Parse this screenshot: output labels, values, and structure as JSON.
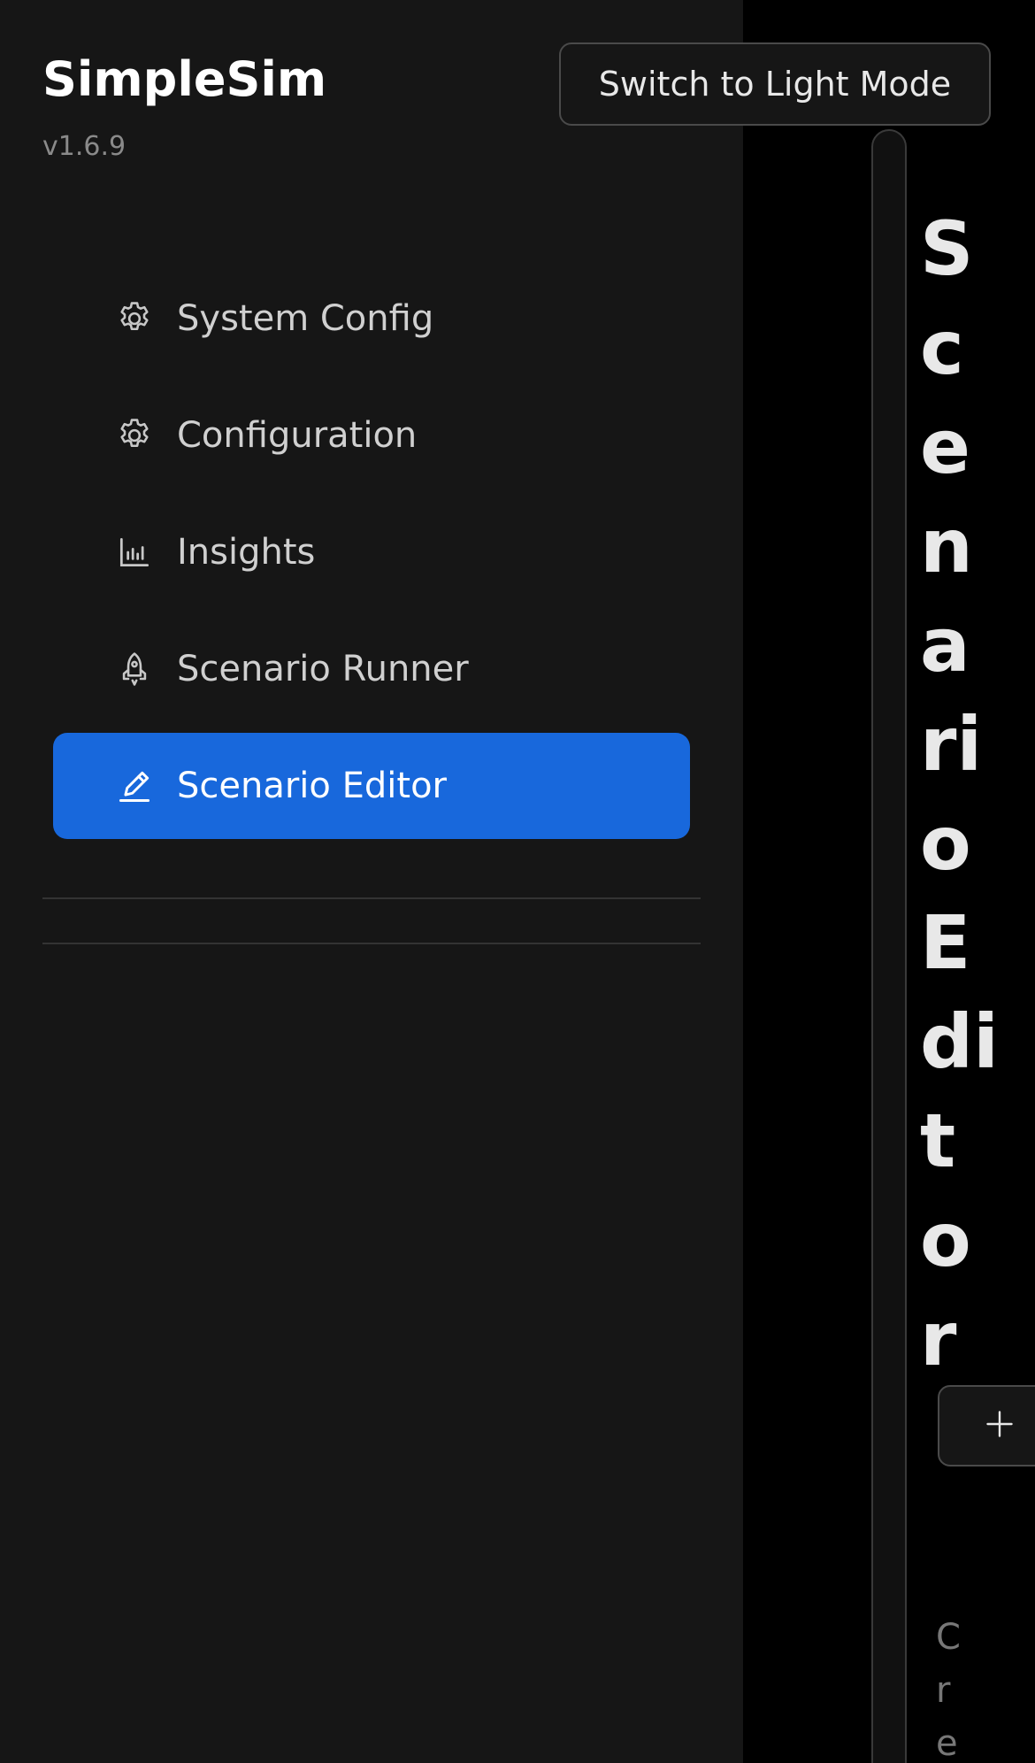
{
  "brand": {
    "title": "SimpleSim",
    "version": "v1.6.9"
  },
  "theme_toggle": {
    "label": "Switch to Light Mode"
  },
  "nav": {
    "items": [
      {
        "label": "System Config",
        "icon": "gear-icon",
        "active": false
      },
      {
        "label": "Configuration",
        "icon": "gear-icon",
        "active": false
      },
      {
        "label": "Insights",
        "icon": "bar-chart-icon",
        "active": false
      },
      {
        "label": "Scenario Runner",
        "icon": "rocket-icon",
        "active": false
      },
      {
        "label": "Scenario Editor",
        "icon": "pencil-icon",
        "active": true
      }
    ]
  },
  "main": {
    "title": "ScenarioEditor",
    "subtitle_fragment": "Cre",
    "add_button_icon": "plus-icon"
  },
  "colors": {
    "sidebar_bg": "#161616",
    "main_bg": "#000000",
    "accent": "#1868dc",
    "text": "#d0d0d0"
  }
}
